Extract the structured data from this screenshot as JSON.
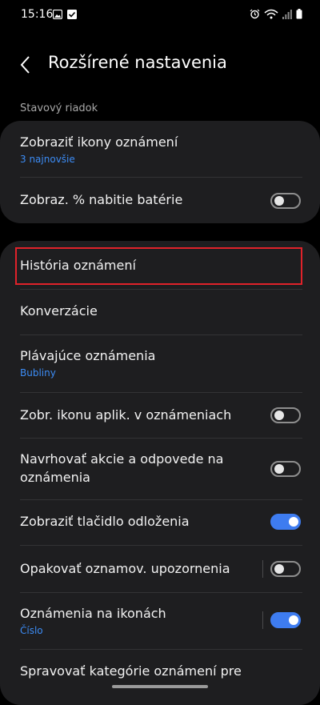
{
  "status_bar": {
    "time": "15:16"
  },
  "header": {
    "title": "Rozšírené nastavenia"
  },
  "section": {
    "label": "Stavový riadok"
  },
  "card1": {
    "rows": [
      {
        "title": "Zobraziť ikony oznámení",
        "subtitle": "3 najnovšie"
      },
      {
        "title": "Zobraz. % nabitie batérie",
        "toggle": "off"
      }
    ]
  },
  "card2": {
    "rows": [
      {
        "title": "História oznámení"
      },
      {
        "title": "Konverzácie"
      },
      {
        "title": "Plávajúce oznámenia",
        "subtitle": "Bubliny"
      },
      {
        "title": "Zobr. ikonu aplik. v oznámeniach",
        "toggle": "off"
      },
      {
        "title_line1": "Navrhovať akcie a odpovede na",
        "title_line2": "oznámenia",
        "toggle": "off"
      },
      {
        "title": "Zobraziť tlačidlo odloženia",
        "toggle": "on"
      },
      {
        "title": "Opakovať oznamov. upozornenia",
        "toggle": "off"
      },
      {
        "title": "Oznámenia na ikonách",
        "subtitle": "Číslo",
        "toggle": "on"
      },
      {
        "title": "Spravovať kategórie oznámení pre"
      }
    ]
  },
  "colors": {
    "accent": "#3e7cf0",
    "subtitle": "#3c8cf5",
    "highlight": "#e0222a",
    "card": "#1e1e20"
  }
}
